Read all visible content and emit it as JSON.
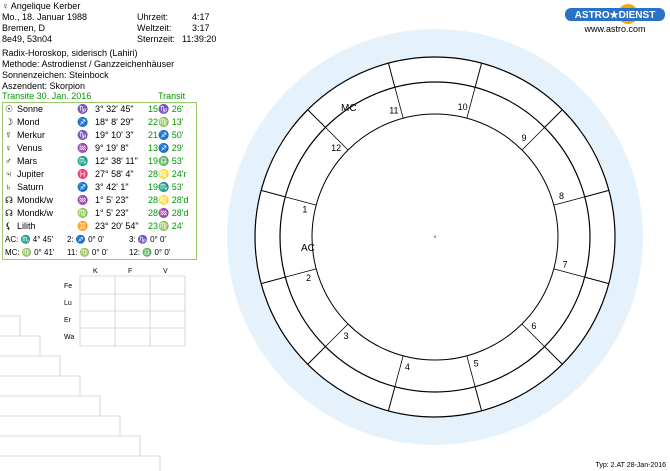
{
  "person": {
    "name": "Angelique Kerber",
    "date": "Mo., 18. Januar 1988",
    "place": "Bremen, D",
    "coords": "8e49, 53n04",
    "uhrzeit_label": "Uhrzeit:",
    "uhrzeit": "4:17",
    "weltzeit_label": "Weltzeit:",
    "weltzeit": "3:17",
    "sternzeit_label": "Sternzeit:",
    "sternzeit": "11:39:20"
  },
  "chart_info": {
    "line1": "Radix-Horoskop, siderisch (Lahiri)",
    "line2": "Methode: Astrodienst / Ganzzeichenhäuser",
    "line3": "Sonnenzeichen: Steinbock",
    "line4": "Aszendent: Skorpion",
    "transit_label": "Transite 30. Jan. 2016",
    "transit_header": "Transit"
  },
  "logo": {
    "brand": "ASTRO★DIENST",
    "url": "www.astro.com"
  },
  "planets": [
    {
      "glyph": "☉",
      "name": "Sonne",
      "sign": "♑",
      "pos": "3° 32' 45\"",
      "transit": "15♑ 26'"
    },
    {
      "glyph": "☽",
      "name": "Mond",
      "sign": "♐",
      "pos": "18° 8' 29\"",
      "transit": "22♍ 13'"
    },
    {
      "glyph": "☿",
      "name": "Merkur",
      "sign": "♑",
      "pos": "19° 10' 3\"",
      "transit": "21♐ 50'"
    },
    {
      "glyph": "♀",
      "name": "Venus",
      "sign": "♒",
      "pos": "9° 19' 8\"",
      "transit": "13♐ 29'"
    },
    {
      "glyph": "♂",
      "name": "Mars",
      "sign": "♏",
      "pos": "12° 38' 11\"",
      "transit": "19♎ 53'"
    },
    {
      "glyph": "♃",
      "name": "Jupiter",
      "sign": "♓",
      "pos": "27° 58' 4\"",
      "transit": "28♌ 24'r"
    },
    {
      "glyph": "♄",
      "name": "Saturn",
      "sign": "♐",
      "pos": "3° 42' 1\"",
      "transit": "19♏ 53'"
    },
    {
      "glyph": "☊",
      "name": "Mondk/w",
      "sign": "♒",
      "pos": "1° 5' 23\"",
      "transit": "28♌ 28'd"
    },
    {
      "glyph": "☊",
      "name": "Mondk/w",
      "sign": "♍",
      "pos": "1° 5' 23\"",
      "transit": "28♒ 28'd"
    },
    {
      "glyph": "⚸",
      "name": "Lilith",
      "sign": "♊",
      "pos": "23° 20' 54\"",
      "transit": "23♍ 24'"
    }
  ],
  "houses_row1": {
    "ac": "AC: ♏ 4° 45'",
    "h2": "2: ♐ 0° 0'",
    "h3": "3: ♑ 0° 0'"
  },
  "houses_row2": {
    "mc": "MC: ♍ 0° 41'",
    "h11": "11: ♍ 0° 0'",
    "h12": "12: ♎ 0° 0'"
  },
  "elements": {
    "cols": [
      "K",
      "F",
      "V"
    ],
    "rows": [
      "Fe",
      "Lu",
      "Er",
      "Wa"
    ]
  },
  "wheel": {
    "house_numbers": [
      "1",
      "2",
      "3",
      "4",
      "5",
      "6",
      "7",
      "8",
      "9",
      "10",
      "11",
      "12"
    ],
    "mc_label": "MC",
    "ac_label": "AC"
  },
  "footer": "Typ: 2.AT  28-Jan-2016"
}
